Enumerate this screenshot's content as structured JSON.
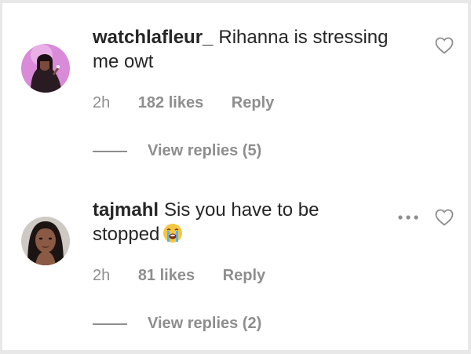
{
  "comments": [
    {
      "username": "watchlafleur_",
      "text_line1": "Rihanna is stressing",
      "text_line2": "me owt",
      "time": "2h",
      "likes": "182 likes",
      "reply": "Reply",
      "view_replies": "View replies (5)",
      "avatar_icon": "profile-photo-woman-pink-background"
    },
    {
      "username": "tajmahl",
      "text_line1": "Sis you have to be",
      "text_line2": "stopped",
      "emoji": "loudly-crying-face-emoji",
      "time": "2h",
      "likes": "81 likes",
      "reply": "Reply",
      "view_replies": "View replies (2)",
      "avatar_icon": "profile-photo-woman-dark-hair"
    }
  ],
  "colors": {
    "text": "#262626",
    "secondary": "#8e8e8e",
    "background": "#ffffff"
  }
}
